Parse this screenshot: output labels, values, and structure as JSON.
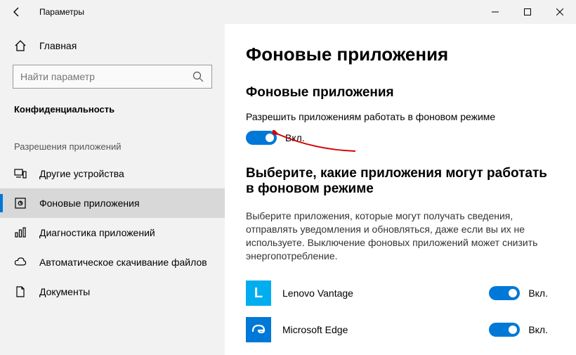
{
  "window": {
    "title": "Параметры"
  },
  "sidebar": {
    "home": "Главная",
    "search_placeholder": "Найти параметр",
    "category": "Конфиденциальность",
    "subhead": "Разрешения приложений",
    "items": [
      {
        "label": "Другие устройства"
      },
      {
        "label": "Фоновые приложения"
      },
      {
        "label": "Диагностика приложений"
      },
      {
        "label": "Автоматическое скачивание файлов"
      },
      {
        "label": "Документы"
      }
    ]
  },
  "content": {
    "page_title": "Фоновые приложения",
    "section1_head": "Фоновые приложения",
    "section1_desc": "Разрешить приложениям работать в фоновом режиме",
    "toggle_on": "Вкл.",
    "section2_head": "Выберите, какие приложения могут работать в фоновом режиме",
    "section2_desc": "Выберите приложения, которые могут получать сведения, отправлять уведомления и обновляться, даже если вы их не используете. Выключение фоновых приложений может снизить энергопотребление.",
    "apps": [
      {
        "name": "Lenovo Vantage",
        "state": "Вкл."
      },
      {
        "name": "Microsoft Edge",
        "state": "Вкл."
      }
    ]
  }
}
